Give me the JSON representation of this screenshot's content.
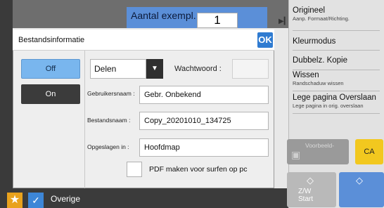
{
  "copies": {
    "label": "Aantal exempl.",
    "value": "1"
  },
  "bottom": {
    "star_icon": "star-icon",
    "check_icon": "check-icon",
    "other_label": "Overige"
  },
  "right_menu": {
    "items": [
      {
        "title": "Origineel",
        "subtitle": "Aanp. Formaat/Richting."
      },
      {
        "title": "Kleurmodus",
        "subtitle": ""
      },
      {
        "title": "Dubbelz. Kopie",
        "subtitle": ""
      },
      {
        "title": "Wissen",
        "subtitle": "Randschaduw wissen"
      },
      {
        "title": "Lege pagina Overslaan",
        "subtitle": "Lege pagina in orig. overslaan"
      }
    ],
    "preview_label": "Voorbeeld-",
    "ca_label": "CA",
    "start_mono_label1": "Z/W",
    "start_mono_label2": "Start"
  },
  "dialog": {
    "title": "Bestandsinformatie",
    "ok_label": "OK",
    "off_label": "Off",
    "on_label": "On",
    "share_select": "Delen",
    "password_label": "Wachtwoord :",
    "password_value": "",
    "user_label": "Gebruikersnaam :",
    "user_value": "Gebr. Onbekend",
    "file_label": "Bestandsnaam :",
    "file_value": "Copy_20201010_134725",
    "stored_label": "Opgeslagen in :",
    "stored_value": "Hoofdmap",
    "pdf_label": "PDF maken voor surfen op pc"
  },
  "colors": {
    "accent": "#2f7bd1",
    "off_selected": "#79b6ee",
    "ca": "#f2c81f"
  }
}
